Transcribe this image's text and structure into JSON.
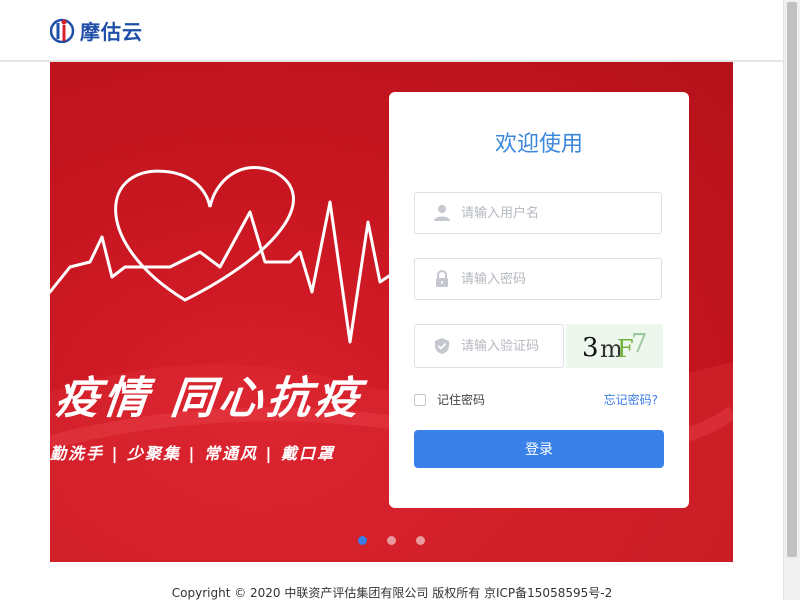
{
  "header": {
    "logo_text": "摩估云",
    "logo_icon": "moguyun-logo-mark"
  },
  "banner": {
    "slogan": "疫情 同心抗疫",
    "sub_slogan": "勤洗手 | 少聚集 | 常通风 | 戴口罩",
    "carousel_count": 3,
    "carousel_active": 1
  },
  "login": {
    "title": "欢迎使用",
    "username_placeholder": "请输入用户名",
    "password_placeholder": "请输入密码",
    "captcha_placeholder": "请输入验证码",
    "captcha_text": [
      "3",
      "m",
      "F",
      "7"
    ],
    "remember_label": "记住密码",
    "remember_checked": false,
    "forgot_label": "忘记密码?",
    "submit_label": "登录",
    "icons": [
      "user-icon",
      "lock-icon",
      "shield-icon"
    ]
  },
  "footer": {
    "copyright": "Copyright © 2020 中联资产评估集团有限公司 版权所有 京ICP备15058595号-2"
  },
  "colors": {
    "accent": "#3a80e9",
    "title": "#3a87dc",
    "banner_red": "#c81620",
    "brand_blue": "#1f4fa8"
  }
}
